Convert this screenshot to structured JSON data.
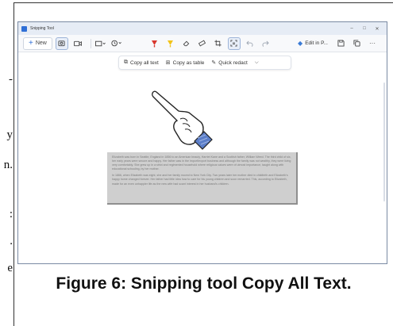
{
  "page": {
    "caption": "Figure 6: Snipping tool Copy All Text.",
    "background_glyphs": [
      "-",
      "y",
      "n.",
      ":",
      ".",
      "e"
    ]
  },
  "window": {
    "title": "Snipping Tool",
    "controls": {
      "minimize": "–",
      "maximize": "□",
      "close": "✕"
    }
  },
  "toolbar": {
    "new_label": "New",
    "edit_in_label": "Edit in P...",
    "more_label": "···"
  },
  "action_bar": {
    "copy_all_text": "Copy all text",
    "copy_as_table": "Copy as table",
    "quick_redact": "Quick redact",
    "chevron": "⌵"
  },
  "snip": {
    "paragraph_1": "Elizabeth was born in Seattle, England in 1856 to an American beauty, Harriet Kane and a Scottish father, William Weed. The third child of six, her early years were secure and happy. Her father was in the import/export business and although the family was not wealthy, they were living very comfortably. She grew up in a strict and regimented household where religious values were of utmost importance, taught along with educational schooling, by her mother.",
    "paragraph_2": "In 1866, when Elizabeth was eight, she and her family moved to New York City. Two years later her mother died in childbirth and Elizabeth's happy home changed forever. Her father had little idea how to care for his young children and soon remarried. This, according to Elizabeth, made for an even unhappier life as the new wife had scant interest in her husband's children."
  },
  "colors": {
    "accent": "#2f6fd6",
    "snip_background": "#cfcfcf",
    "window_border": "#7a8aa3"
  }
}
